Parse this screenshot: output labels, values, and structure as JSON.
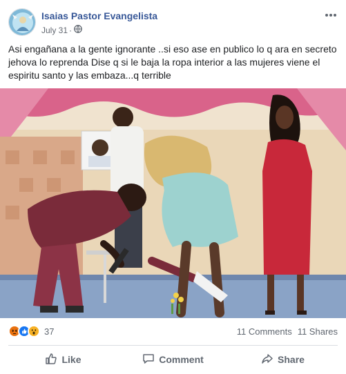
{
  "post": {
    "author": "Isaias Pastor Evangelista",
    "date": "July 31",
    "privacy_icon": "globe-icon",
    "more_icon": "ellipsis-icon",
    "text": "Asi engañana a la gente ignorante ..si eso ase en publico lo q ara en secreto jehova lo reprenda Dise q si le baja la ropa interior a las mujeres viene el espiritu santo y las embaza...q terrible"
  },
  "reactions": {
    "icons": [
      "angry-reaction-icon",
      "like-reaction-icon",
      "wow-reaction-icon"
    ],
    "count": "37",
    "comments": "11 Comments",
    "shares": "11 Shares"
  },
  "actions": {
    "like": "Like",
    "comment": "Comment",
    "share": "Share"
  },
  "colors": {
    "author_blue": "#385898",
    "muted_text": "#606770",
    "angry": "#e9710f",
    "like": "#1877f2",
    "wow": "#f7b125"
  }
}
